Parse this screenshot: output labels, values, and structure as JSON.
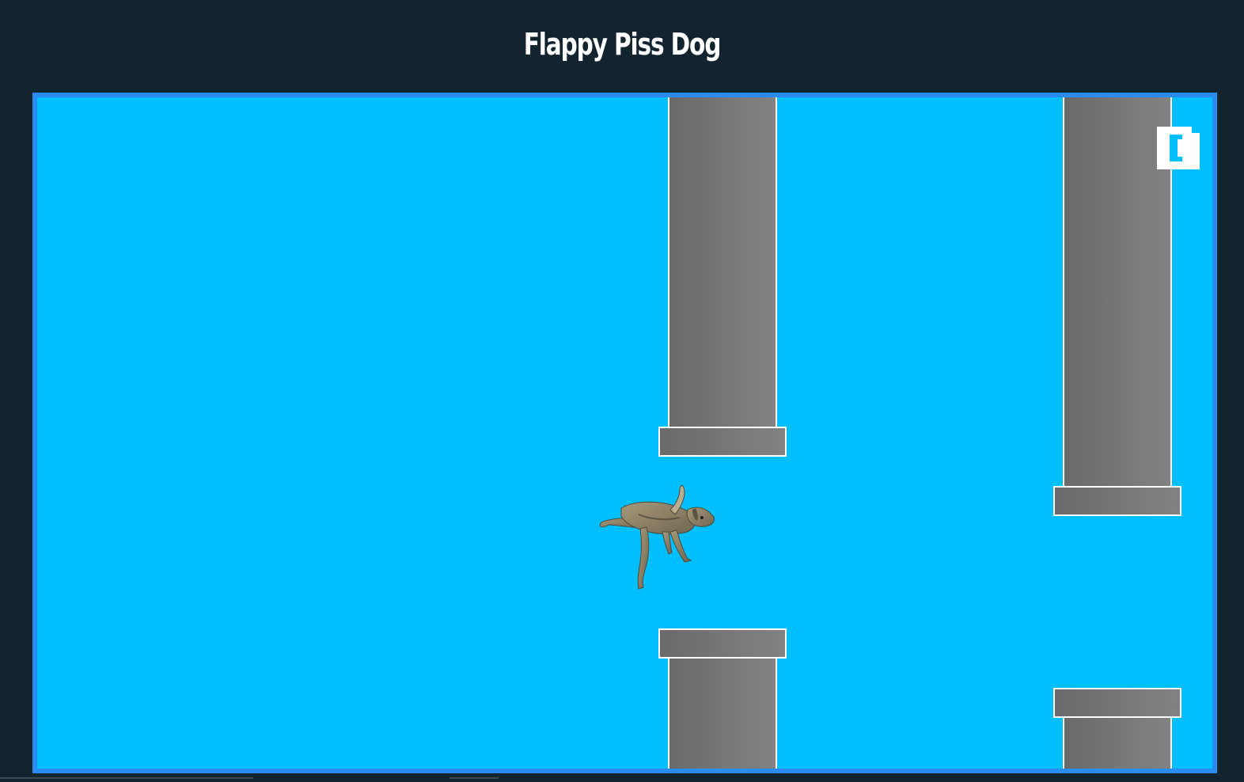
{
  "page": {
    "title": "Flappy Piss Dog"
  },
  "game": {
    "score": "0",
    "player": "dog",
    "colors": {
      "page_background": "#12242d",
      "sky": "#00bfff",
      "frame_border": "#2a8cf0",
      "pipe": "#777777",
      "pipe_outline": "#ffffff",
      "score": "#ffffff"
    },
    "icons": [
      "dog-sprite",
      "score-digit-zero"
    ]
  }
}
